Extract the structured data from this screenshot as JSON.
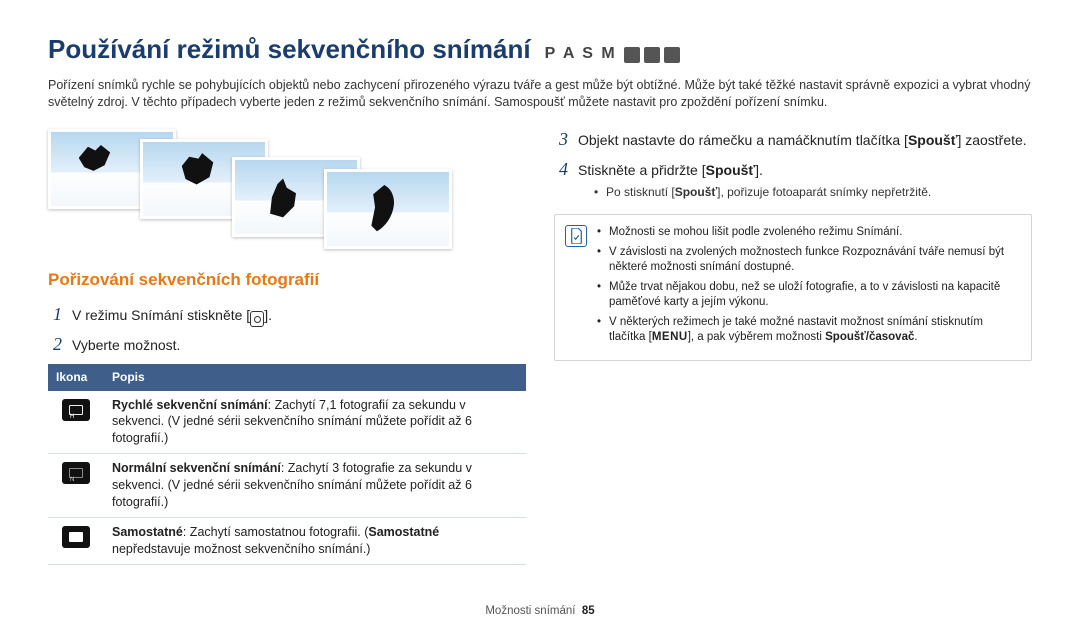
{
  "title": "Používání režimů sekvenčního snímání",
  "modes_letters": "P A S M",
  "intro": "Pořízení snímků rychle se pohybujících objektů nebo zachycení přirozeného výrazu tváře a gest může být obtížné. Může být také těžké nastavit správně expozici a vybrat vhodný světelný zdroj. V těchto případech vyberte jeden z režimů sekvenčního snímání. Samospoušť můžete nastavit pro zpoždění pořízení snímku.",
  "section_heading": "Pořizování sekvenčních fotografií",
  "steps": {
    "s1": {
      "num": "1",
      "pre": "V režimu Snímání stiskněte [",
      "post": "]."
    },
    "s2": {
      "num": "2",
      "text": "Vyberte možnost."
    },
    "s3": {
      "num": "3",
      "pre": "Objekt nastavte do rámečku a namáčknutím tlačítka [",
      "btn": "Spoušť",
      "post": "] zaostřete."
    },
    "s4": {
      "num": "4",
      "pre": "Stiskněte a přidržte [",
      "btn": "Spoušť",
      "post": "]."
    },
    "s4_bullet": {
      "pre": "Po stisknutí [",
      "btn": "Spoušť",
      "post": "], pořizuje fotoaparát snímky nepřetržitě."
    }
  },
  "table": {
    "headers": {
      "icon": "Ikona",
      "desc": "Popis"
    },
    "rows": [
      {
        "bold": "Rychlé sekvenční snímání",
        "rest": ": Zachytí 7,1 fotografií za sekundu v sekvenci. (V jedné sérii sekvenčního snímání můžete pořídit až 6 fotografií.)"
      },
      {
        "bold": "Normální sekvenční snímání",
        "rest": ": Zachytí 3 fotografie za sekundu v sekvenci. (V jedné sérii sekvenčního snímání můžete pořídit až 6 fotografií.)"
      },
      {
        "bold": "Samostatné",
        "rest_pre": ": Zachytí samostatnou fotografii. (",
        "bold2": "Samostatné",
        "rest_post": " nepředstavuje možnost sekvenčního snímání.)"
      }
    ]
  },
  "notes": {
    "n1": "Možnosti se mohou lišit podle zvoleného režimu Snímání.",
    "n2": "V závislosti na zvolených možnostech funkce Rozpoznávání tváře nemusí být některé možnosti snímání dostupné.",
    "n3": "Může trvat nějakou dobu, než se uloží fotografie, a to v závislosti na kapacitě paměťové karty a jejím výkonu.",
    "n4_pre": "V některých režimech je také možné nastavit možnost snímání stisknutím tlačítka [",
    "n4_menu": "MENU",
    "n4_mid": "], a pak výběrem možnosti ",
    "n4_bold": "Spoušť/časovač",
    "n4_post": "."
  },
  "footer": {
    "label": "Možnosti snímání",
    "page": "85"
  }
}
